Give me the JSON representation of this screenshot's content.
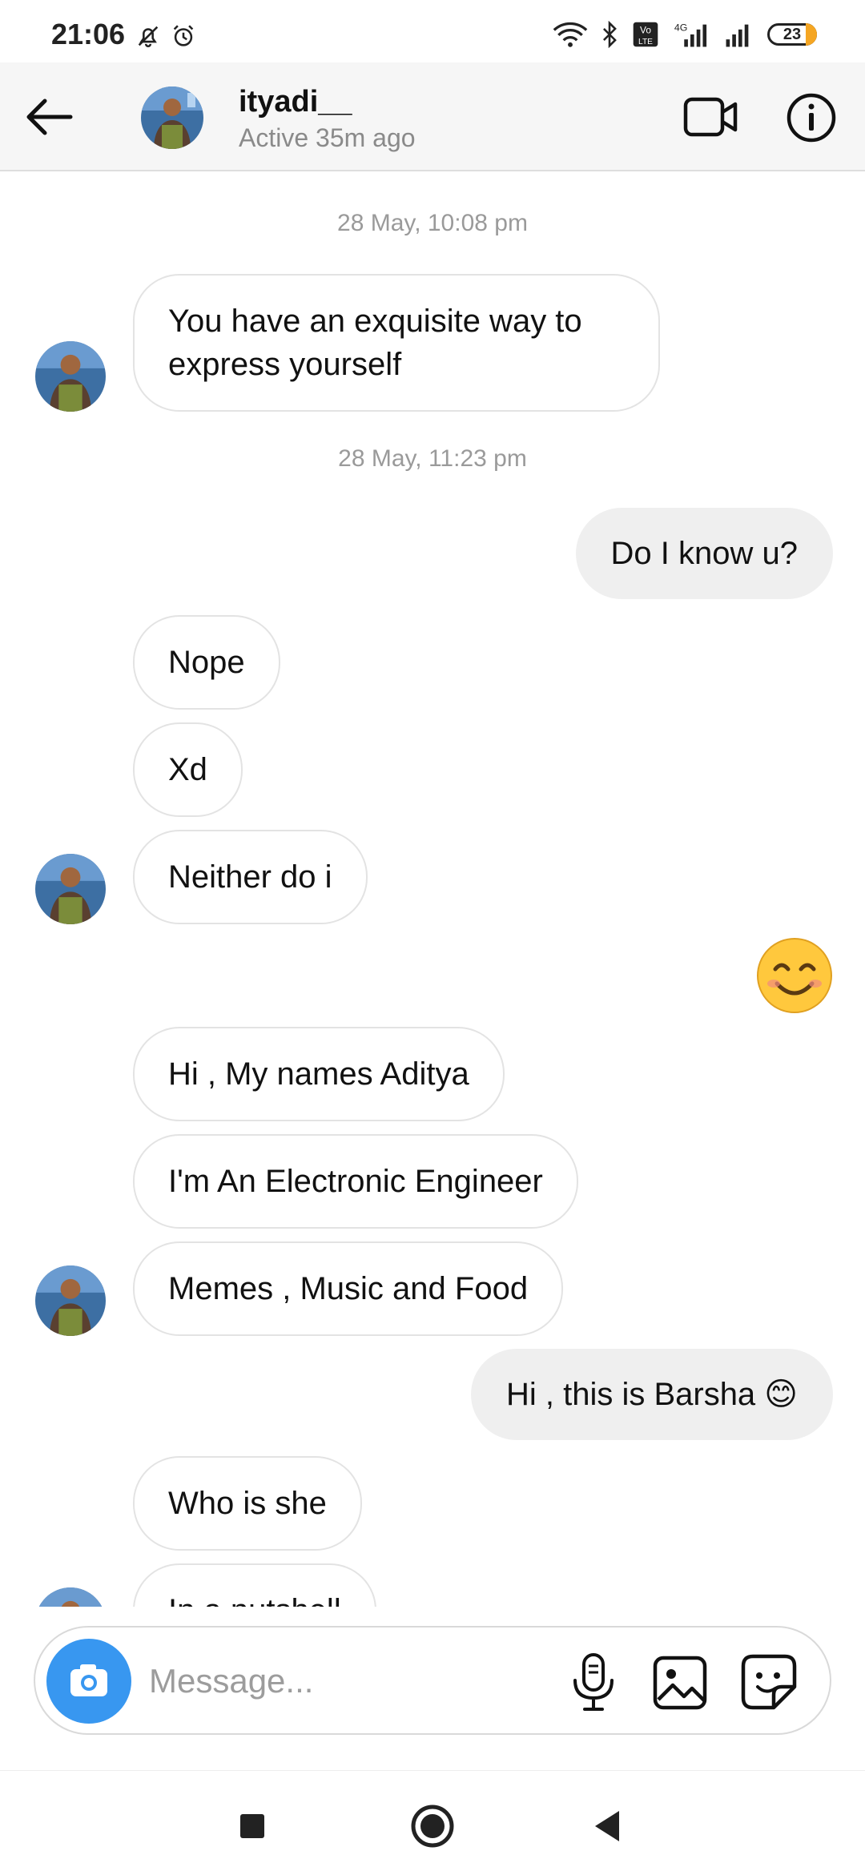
{
  "status_bar": {
    "time": "21:06",
    "battery": "23",
    "icons": [
      "mute-bell-icon",
      "alarm-icon",
      "wifi-icon",
      "bluetooth-icon",
      "volte-icon",
      "signal-4g-icon",
      "signal-icon",
      "battery-icon"
    ]
  },
  "header": {
    "name": "ityadi__",
    "status": "Active 35m ago",
    "icons": [
      "back-arrow-icon",
      "video-call-icon",
      "info-icon"
    ]
  },
  "messages": [
    {
      "type": "timestamp",
      "text": "28 May, 10:08 pm"
    },
    {
      "type": "incoming",
      "text": "You have an exquisite way to express yourself",
      "avatar": true
    },
    {
      "type": "timestamp",
      "text": "28 May, 11:23 pm"
    },
    {
      "type": "outgoing",
      "text": "Do I know u?"
    },
    {
      "type": "incoming",
      "text": "Nope"
    },
    {
      "type": "incoming",
      "text": "Xd"
    },
    {
      "type": "incoming",
      "text": "Neither do i",
      "avatar": true
    },
    {
      "type": "outgoing-emoji",
      "text": "😊"
    },
    {
      "type": "incoming",
      "text": "Hi , My names Aditya"
    },
    {
      "type": "incoming",
      "text": "I'm An Electronic Engineer"
    },
    {
      "type": "incoming",
      "text": "Memes , Music and Food",
      "avatar": true
    },
    {
      "type": "outgoing",
      "text": "Hi , this is Barsha 😊"
    },
    {
      "type": "incoming",
      "text": "Who is she"
    },
    {
      "type": "incoming",
      "text": "In a nutshell",
      "avatar": true
    }
  ],
  "composer": {
    "placeholder": "Message...",
    "icons": [
      "camera-icon",
      "microphone-icon",
      "gallery-icon",
      "sticker-icon"
    ]
  },
  "colors": {
    "accent_blue": "#3897f0",
    "outgoing_bubble": "#efefef",
    "incoming_border": "#e3e3e3",
    "timestamp_gray": "#9a9a9a",
    "battery_orange": "#f5a623"
  },
  "nav_bar": {
    "icons": [
      "recents-square-icon",
      "home-circle-icon",
      "back-triangle-icon"
    ]
  }
}
